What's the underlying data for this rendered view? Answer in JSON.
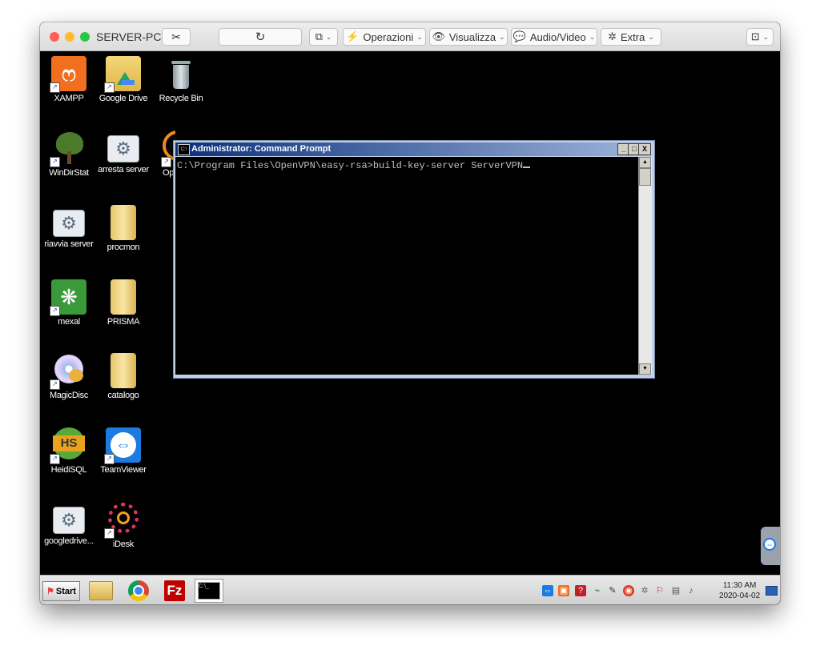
{
  "window": {
    "title": "SERVER-PC",
    "toolbar": [
      {
        "label": "Operazioni",
        "icon": "⚡"
      },
      {
        "label": "Visualizza",
        "icon": "👁"
      },
      {
        "label": "Audio/Video",
        "icon": "💬"
      },
      {
        "label": "Extra",
        "icon": "✲"
      }
    ],
    "colors": {
      "close": "#ff5f57",
      "minimize": "#febc2e",
      "zoom": "#28c840"
    }
  },
  "desktop": {
    "icons": [
      {
        "label": "XAMPP"
      },
      {
        "label": "Google Drive"
      },
      {
        "label": "Recycle Bin"
      },
      {
        "label": "WinDirStat"
      },
      {
        "label": "arresta server"
      },
      {
        "label": "Ope"
      },
      {
        "label": "riavvia server"
      },
      {
        "label": "procmon"
      },
      {
        "label": "mexal"
      },
      {
        "label": "PRISMA"
      },
      {
        "label": "MagicDisc"
      },
      {
        "label": "catalogo"
      },
      {
        "label": "HeidiSQL"
      },
      {
        "label": "TeamViewer"
      },
      {
        "label": "googledrive..."
      },
      {
        "label": "iDesk"
      }
    ]
  },
  "cmd": {
    "title": "Administrator: Command Prompt",
    "prompt_line": "C:\\Program Files\\OpenVPN\\easy-rsa>build-key-server ServerVPN",
    "buttons": [
      "_",
      "□",
      "X"
    ]
  },
  "taskbar": {
    "start_label": "Start",
    "clock_time": "11:30 AM",
    "clock_date": "2020-04-02"
  }
}
